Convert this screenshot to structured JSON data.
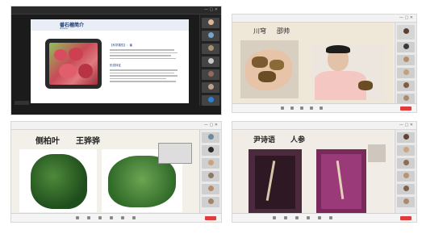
{
  "shots": [
    {
      "id": "top-left",
      "slide": {
        "title": "番石榴简介",
        "subtitle": "Guava",
        "section1_title": "【科学属性】：番",
        "section2_title": "形态特征"
      },
      "colors": {
        "slide_bg": "#ffffff",
        "accent": "#1d3c78"
      }
    },
    {
      "id": "top-right",
      "overlay": {
        "left": "川穹",
        "right": "邵帅"
      }
    },
    {
      "id": "bottom-left",
      "overlay": {
        "left": "侧柏叶",
        "right": "王骅骅"
      }
    },
    {
      "id": "bottom-right",
      "overlay": {
        "left": "尹诗语",
        "right": "人参"
      }
    }
  ],
  "icons": [
    "mic-icon",
    "camera-icon",
    "share-icon",
    "participants-icon",
    "chat-icon",
    "record-icon",
    "leave-button"
  ],
  "colors": {
    "leave": "#e23b3b",
    "toolbar": "#f4f4f4",
    "panel": "#e9e9e9"
  }
}
